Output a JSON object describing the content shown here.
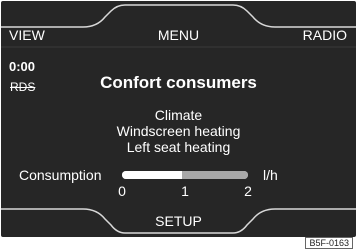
{
  "top_bar": {
    "left": "VIEW",
    "center": "MENU",
    "right": "RADIO"
  },
  "status": {
    "time": "0:00",
    "rds": "RDS"
  },
  "title": "Confort consumers",
  "consumers": [
    "Climate",
    "Windscreen heating",
    "Left seat heating"
  ],
  "consumption": {
    "label": "Consumption",
    "unit": "l/h",
    "scale_ticks": [
      "0",
      "1",
      "2"
    ],
    "scale_max": 2,
    "value": 0.95
  },
  "bottom_bar": {
    "center": "SETUP"
  },
  "figure_code": "B5F-0163",
  "colors": {
    "screen_bg": "#262626",
    "frame_line": "#d8d8d8",
    "text": "#ffffff"
  }
}
